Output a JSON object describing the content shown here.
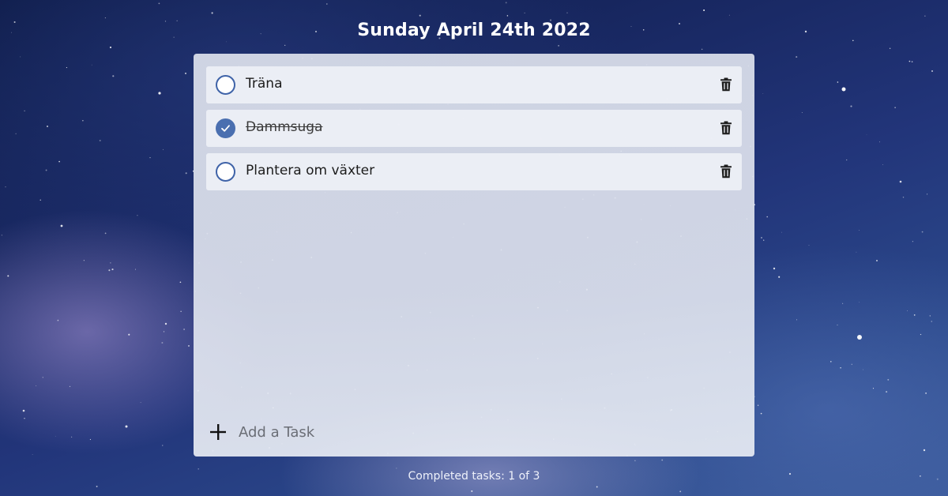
{
  "header": {
    "date": "Sunday April 24th 2022"
  },
  "tasks": [
    {
      "label": "Träna",
      "completed": false
    },
    {
      "label": "Dammsuga",
      "completed": true
    },
    {
      "label": "Plantera om växter",
      "completed": false
    }
  ],
  "add_task": {
    "placeholder": "Add a Task",
    "value": ""
  },
  "footer": {
    "status": "Completed tasks: 1 of 3"
  },
  "colors": {
    "accent": "#4a6fb0",
    "check_border": "#3f63a8"
  },
  "icons": {
    "check": "checkmark-icon",
    "delete": "trash-icon",
    "add": "plus-icon"
  }
}
